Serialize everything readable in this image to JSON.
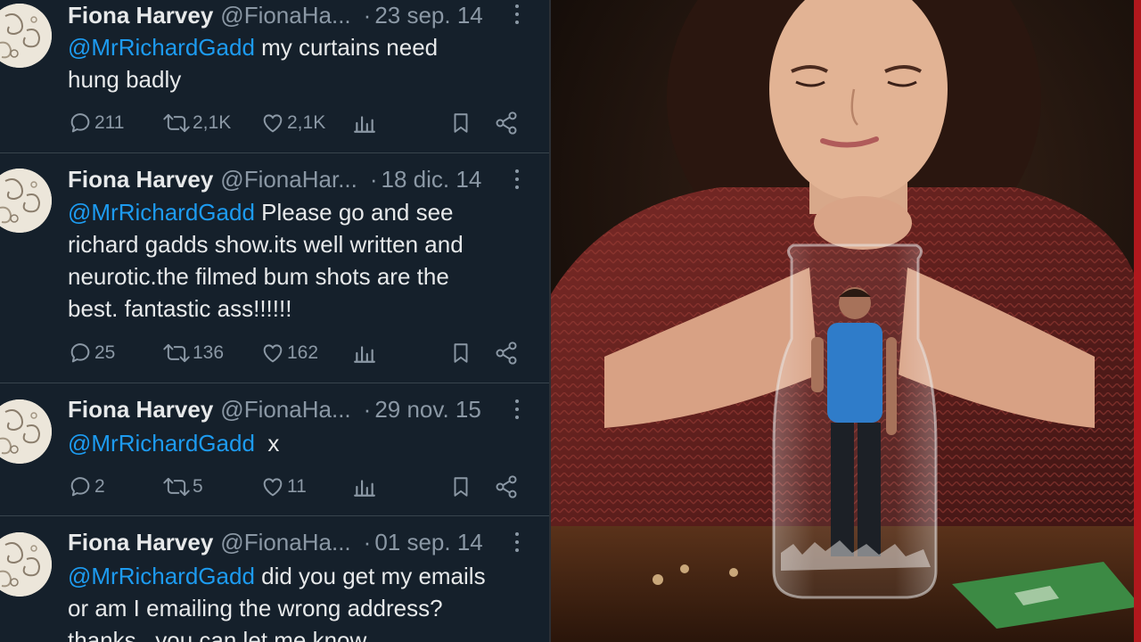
{
  "tweets": [
    {
      "name": "Fiona Harvey",
      "handle": "@FionaHa...",
      "separator": "·",
      "date": "23 sep. 14",
      "mention": "@MrRichardGadd",
      "text_lines": [
        " my curtains need",
        "hung badly"
      ],
      "replies": "211",
      "retweets": "2,1K",
      "likes": "2,1K"
    },
    {
      "name": "Fiona Harvey",
      "handle": "@FionaHar...",
      "separator": "·",
      "date": "18 dic. 14",
      "mention": "@MrRichardGadd",
      "text_lines": [
        " Please go and see",
        "richard gadds show.its well written and",
        "neurotic.the filmed bum shots are the",
        "best. fantastic ass!!!!!!"
      ],
      "replies": "25",
      "retweets": "136",
      "likes": "162"
    },
    {
      "name": "Fiona Harvey",
      "handle": "@FionaHa...",
      "separator": "·",
      "date": "29 nov. 15",
      "mention": "@MrRichardGadd",
      "text_lines": [
        "  x"
      ],
      "replies": "2",
      "retweets": "5",
      "likes": "11"
    },
    {
      "name": "Fiona Harvey",
      "handle": "@FionaHa...",
      "separator": "·",
      "date": "01 sep. 14",
      "mention": "@MrRichardGadd",
      "text_lines": [
        " did you get my emails",
        "or am I emailing the wrong address?",
        "thanks , you can let me know"
      ],
      "replies": "",
      "retweets": "",
      "likes": ""
    }
  ],
  "icons": {
    "reply": "reply-icon",
    "retweet": "retweet-icon",
    "like": "heart-icon",
    "views": "views-icon",
    "bookmark": "bookmark-icon",
    "share": "share-icon",
    "more": "more-options-icon"
  },
  "colors": {
    "background": "#15202b",
    "text": "#e7e9ea",
    "muted": "#8b98a5",
    "mention": "#1d9bf0",
    "border": "#38444d"
  },
  "photo": {
    "subject": "woman-with-man-in-glass-jar"
  }
}
